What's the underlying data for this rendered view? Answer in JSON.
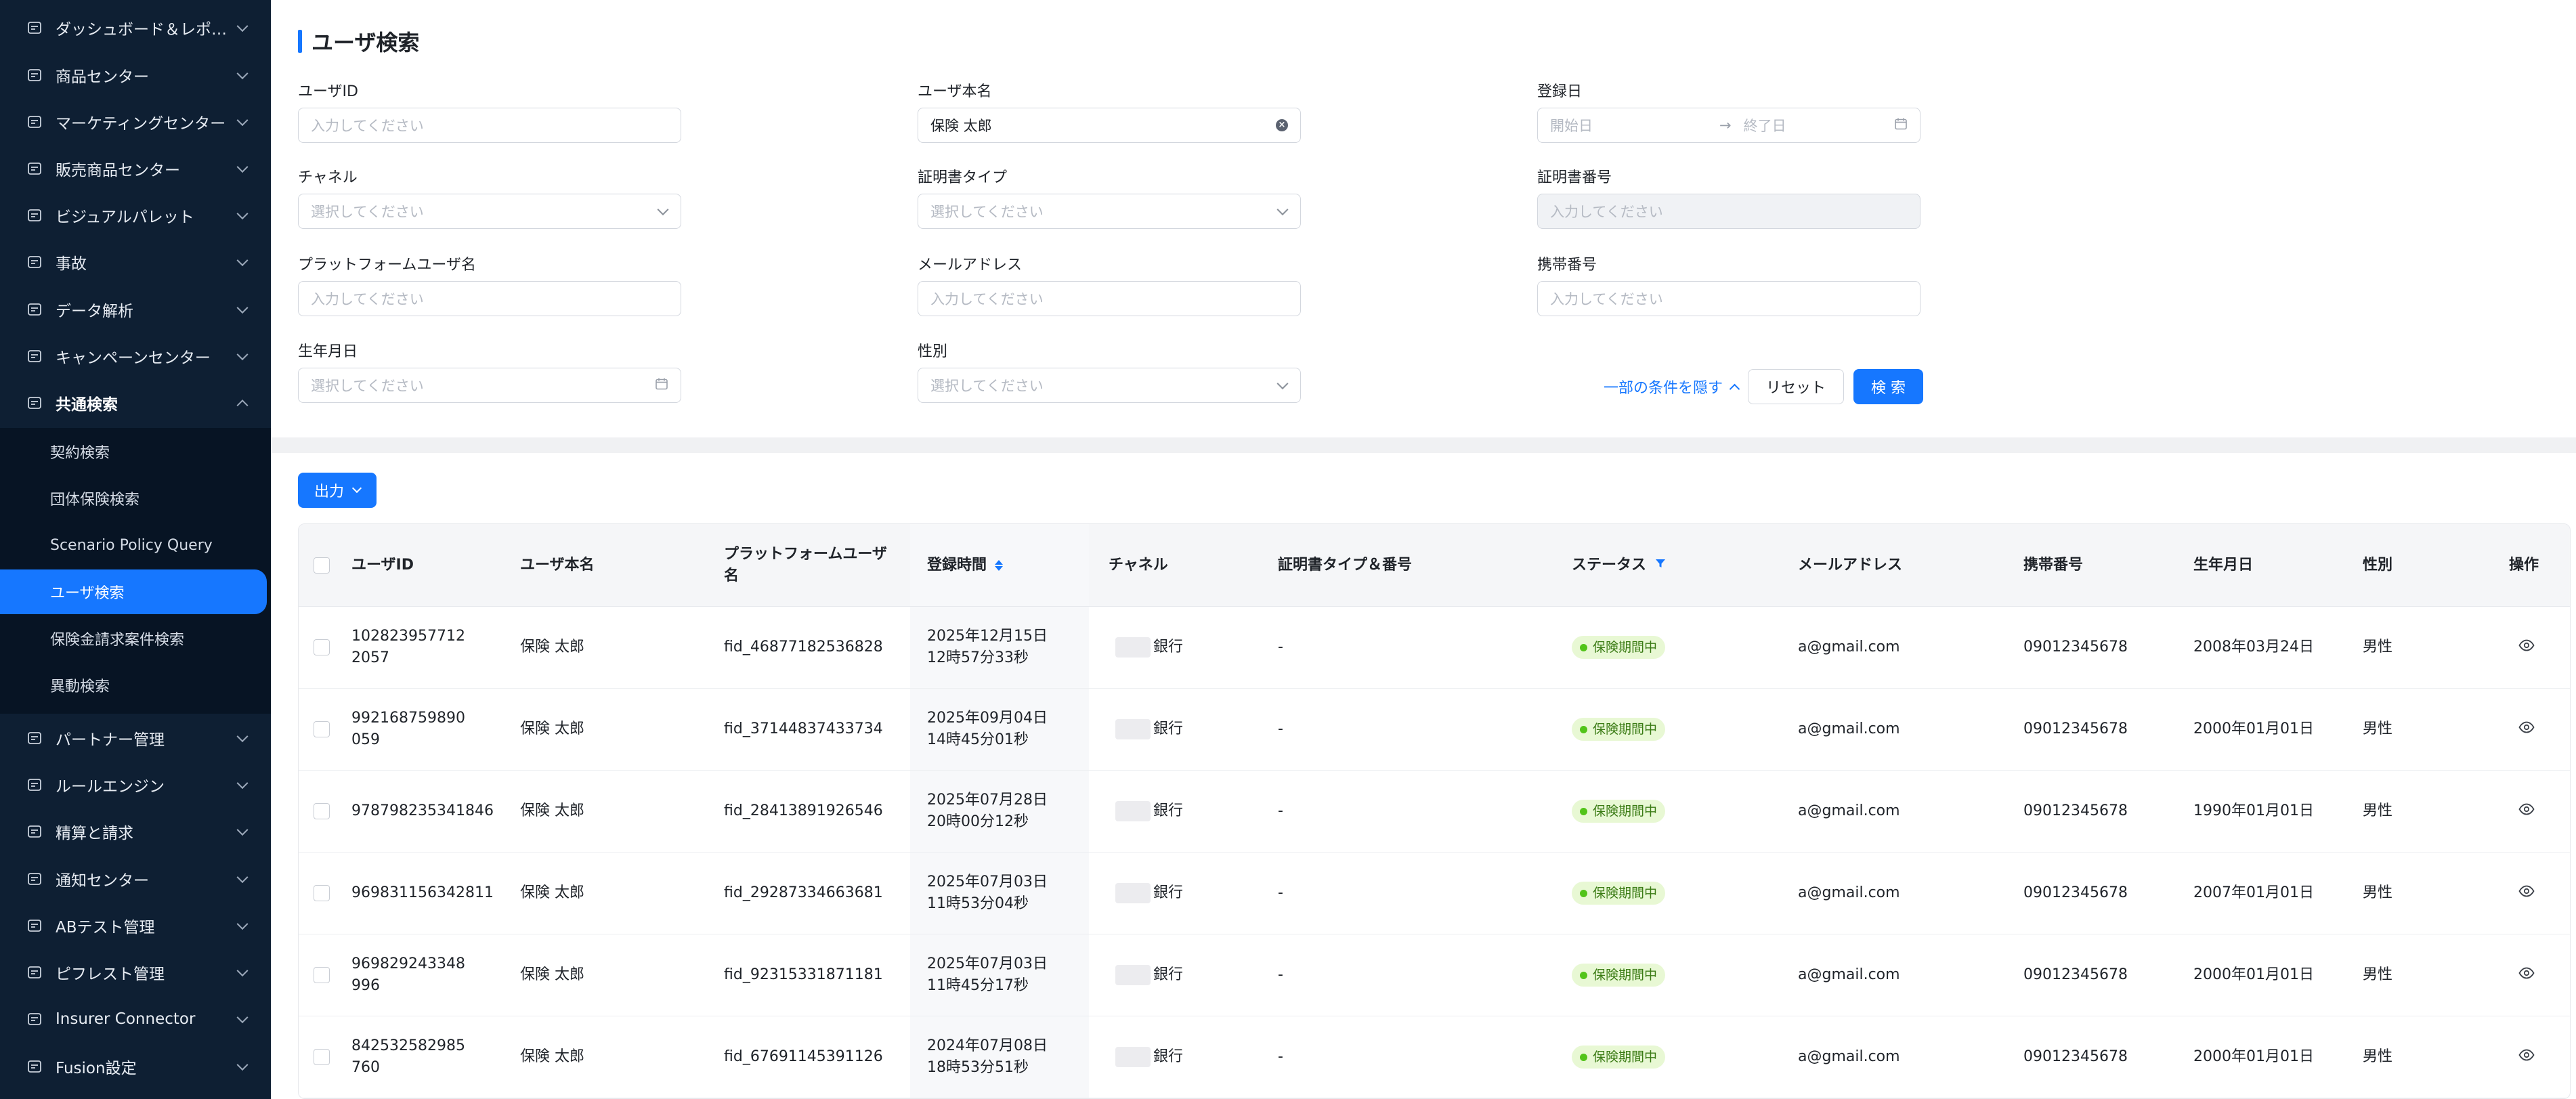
{
  "sidebar": {
    "items": [
      {
        "label": "ダッシュボード＆レポ…",
        "icon": "dashboard-icon"
      },
      {
        "label": "商品センター",
        "icon": "product-icon"
      },
      {
        "label": "マーケティングセンター",
        "icon": "marketing-icon"
      },
      {
        "label": "販売商品センター",
        "icon": "sales-product-icon"
      },
      {
        "label": "ビジュアルパレット",
        "icon": "palette-icon"
      },
      {
        "label": "事故",
        "icon": "accident-icon"
      },
      {
        "label": "データ解析",
        "icon": "analytics-icon"
      },
      {
        "label": "キャンペーンセンター",
        "icon": "campaign-icon"
      },
      {
        "label": "共通検索",
        "icon": "search-doc-icon"
      },
      {
        "label": "パートナー管理",
        "icon": "partner-icon"
      },
      {
        "label": "ルールエンジン",
        "icon": "rule-engine-icon"
      },
      {
        "label": "精算と請求",
        "icon": "billing-icon"
      },
      {
        "label": "通知センター",
        "icon": "bell-icon"
      },
      {
        "label": "ABテスト管理",
        "icon": "ab-test-icon"
      },
      {
        "label": "ピフレスト管理",
        "icon": "bifrost-icon"
      },
      {
        "label": "Insurer Connector",
        "icon": "connector-icon"
      },
      {
        "label": "Fusion設定",
        "icon": "fusion-icon"
      }
    ],
    "submenu": [
      {
        "label": "契約検索"
      },
      {
        "label": "団体保険検索"
      },
      {
        "label": "Scenario Policy Query"
      },
      {
        "label": "ユーザ検索"
      },
      {
        "label": "保険金請求案件検索"
      },
      {
        "label": "異動検索"
      }
    ]
  },
  "search": {
    "title": "ユーザ検索",
    "fields": {
      "user_id": {
        "label": "ユーザID",
        "placeholder": "入力してください"
      },
      "user_name": {
        "label": "ユーザ本名",
        "value": "保険 太郎"
      },
      "reg_date": {
        "label": "登録日",
        "start_placeholder": "開始日",
        "end_placeholder": "終了日"
      },
      "channel": {
        "label": "チャネル",
        "placeholder": "選択してください"
      },
      "cert_type": {
        "label": "証明書タイプ",
        "placeholder": "選択してください"
      },
      "cert_no": {
        "label": "証明書番号",
        "placeholder": "入力してください"
      },
      "platform_user": {
        "label": "プラットフォームユーザ名",
        "placeholder": "入力してください"
      },
      "email": {
        "label": "メールアドレス",
        "placeholder": "入力してください"
      },
      "phone": {
        "label": "携帯番号",
        "placeholder": "入力してください"
      },
      "birthday": {
        "label": "生年月日",
        "placeholder": "選択してください"
      },
      "gender": {
        "label": "性別",
        "placeholder": "選択してください"
      }
    },
    "toggle_label": "一部の条件を隠す",
    "reset_label": "リセット",
    "search_label": "検 索"
  },
  "table": {
    "export_label": "出力",
    "headers": {
      "user_id": "ユーザID",
      "user_name": "ユーザ本名",
      "platform_user": "プラットフォームユーザ名",
      "reg_time": "登録時間",
      "channel": "チャネル",
      "cert": "証明書タイプ＆番号",
      "status": "ステータス",
      "email": "メールアドレス",
      "phone": "携帯番号",
      "birthday": "生年月日",
      "gender": "性別",
      "ops": "操作"
    },
    "rows": [
      {
        "user_id": "1028239577122057",
        "user_name": "保険 太郎",
        "platform_user": "fid_46877182536828",
        "reg_time": "2025年12月15日 12時57分33秒",
        "channel": "銀行",
        "cert": "-",
        "status": "保険期間中",
        "email": "a@gmail.com",
        "phone": "09012345678",
        "birthday": "2008年03月24日",
        "gender": "男性"
      },
      {
        "user_id": "992168759890059",
        "user_name": "保険 太郎",
        "platform_user": "fid_37144837433734",
        "reg_time": "2025年09月04日 14時45分01秒",
        "channel": "銀行",
        "cert": "-",
        "status": "保険期間中",
        "email": "a@gmail.com",
        "phone": "09012345678",
        "birthday": "2000年01月01日",
        "gender": "男性"
      },
      {
        "user_id": "978798235341846",
        "user_name": "保険 太郎",
        "platform_user": "fid_28413891926546",
        "reg_time": "2025年07月28日 20時00分12秒",
        "channel": "銀行",
        "cert": "-",
        "status": "保険期間中",
        "email": "a@gmail.com",
        "phone": "09012345678",
        "birthday": "1990年01月01日",
        "gender": "男性"
      },
      {
        "user_id": "969831156342811",
        "user_name": "保険 太郎",
        "platform_user": "fid_29287334663681",
        "reg_time": "2025年07月03日 11時53分04秒",
        "channel": "銀行",
        "cert": "-",
        "status": "保険期間中",
        "email": "a@gmail.com",
        "phone": "09012345678",
        "birthday": "2007年01月01日",
        "gender": "男性"
      },
      {
        "user_id": "969829243348996",
        "user_name": "保険 太郎",
        "platform_user": "fid_92315331871181",
        "reg_time": "2025年07月03日 11時45分17秒",
        "channel": "銀行",
        "cert": "-",
        "status": "保険期間中",
        "email": "a@gmail.com",
        "phone": "09012345678",
        "birthday": "2000年01月01日",
        "gender": "男性"
      },
      {
        "user_id": "842532582985760",
        "user_name": "保険 太郎",
        "platform_user": "fid_67691145391126",
        "reg_time": "2024年07月08日 18時53分51秒",
        "channel": "銀行",
        "cert": "-",
        "status": "保険期間中",
        "email": "a@gmail.com",
        "phone": "09012345678",
        "birthday": "2000年01月01日",
        "gender": "男性"
      }
    ]
  },
  "colors": {
    "sidebar_bg": "#0e1f33",
    "accent": "#1677ff",
    "status_bg": "#e8f8d4",
    "status_dot": "#52c41a"
  }
}
